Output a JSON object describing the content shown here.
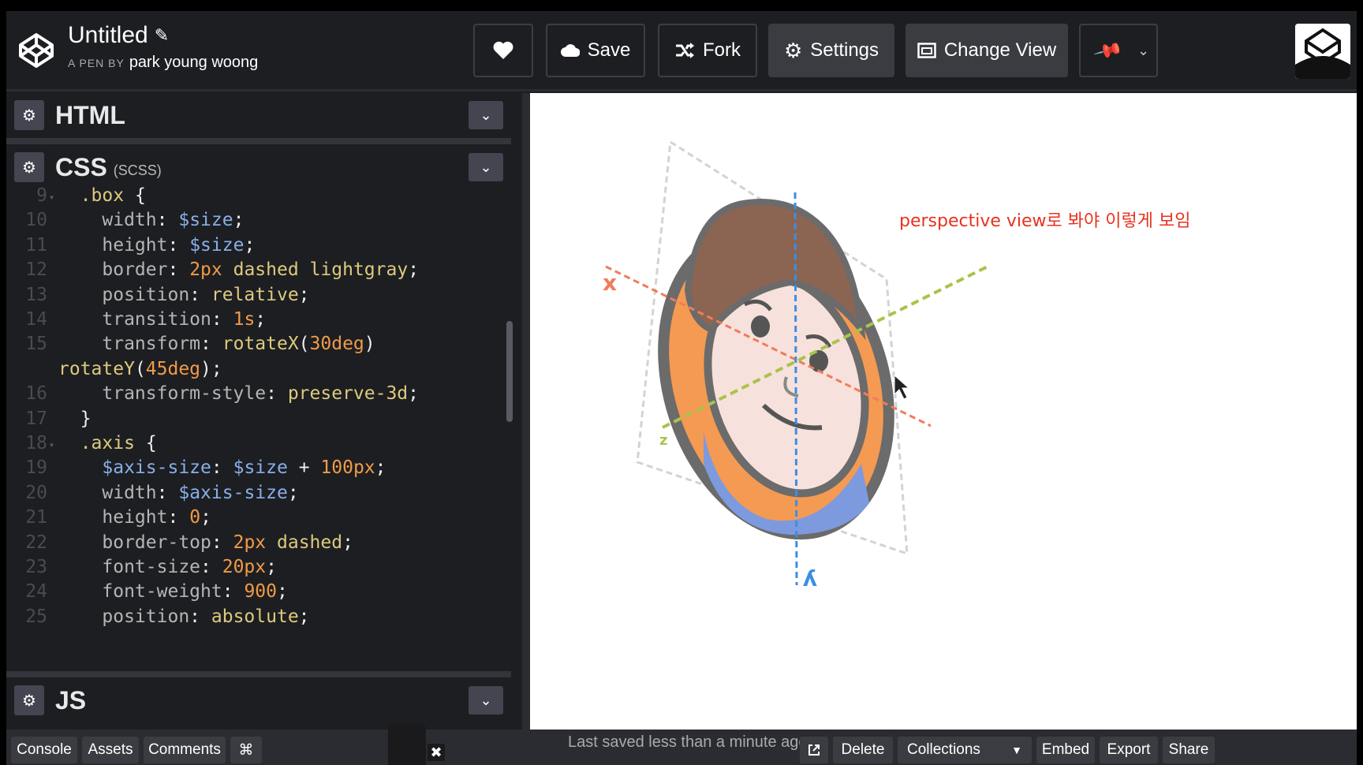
{
  "header": {
    "pen_title": "Untitled",
    "pen_by_prefix": "A PEN BY",
    "author": "park young woong",
    "save_label": "Save",
    "fork_label": "Fork",
    "settings_label": "Settings",
    "change_view_label": "Change View"
  },
  "editors": {
    "html_title": "HTML",
    "css_title": "CSS",
    "css_sub": "(SCSS)",
    "js_title": "JS"
  },
  "code_lines": [
    {
      "n": "9",
      "fold": true,
      "text": "  .box {"
    },
    {
      "n": "10",
      "text": "    width: $size;"
    },
    {
      "n": "11",
      "text": "    height: $size;"
    },
    {
      "n": "12",
      "text": "    border: 2px dashed lightgray;"
    },
    {
      "n": "13",
      "text": "    position: relative;"
    },
    {
      "n": "14",
      "text": "    transition: 1s;"
    },
    {
      "n": "15",
      "text": "    transform: rotateX(30deg)"
    },
    {
      "n": "",
      "text": "rotateY(45deg);"
    },
    {
      "n": "16",
      "text": "    transform-style: preserve-3d;"
    },
    {
      "n": "17",
      "text": "  }"
    },
    {
      "n": "18",
      "fold": true,
      "text": "  .axis {"
    },
    {
      "n": "19",
      "text": "    $axis-size: $size + 100px;"
    },
    {
      "n": "20",
      "text": "    width: $axis-size;"
    },
    {
      "n": "21",
      "text": "    height: 0;"
    },
    {
      "n": "22",
      "text": "    border-top: 2px dashed;"
    },
    {
      "n": "23",
      "text": "    font-size: 20px;"
    },
    {
      "n": "24",
      "text": "    font-weight: 900;"
    },
    {
      "n": "25",
      "text": "    position: absolute;"
    }
  ],
  "preview": {
    "annotation": "perspective view로 봐야 이렇게 보임",
    "axis_x": "x",
    "axis_y": "y",
    "axis_z": "z"
  },
  "footer": {
    "console": "Console",
    "assets": "Assets",
    "comments": "Comments",
    "shortcut": "⌘",
    "status": "Last saved less than a minute ago",
    "delete": "Delete",
    "collections": "Collections",
    "embed": "Embed",
    "export": "Export",
    "share": "Share"
  },
  "colors": {
    "accent_red": "#e8321e",
    "axis_x": "#f07c5a",
    "axis_y": "#3a8ee6",
    "axis_z": "#a8c44a"
  }
}
